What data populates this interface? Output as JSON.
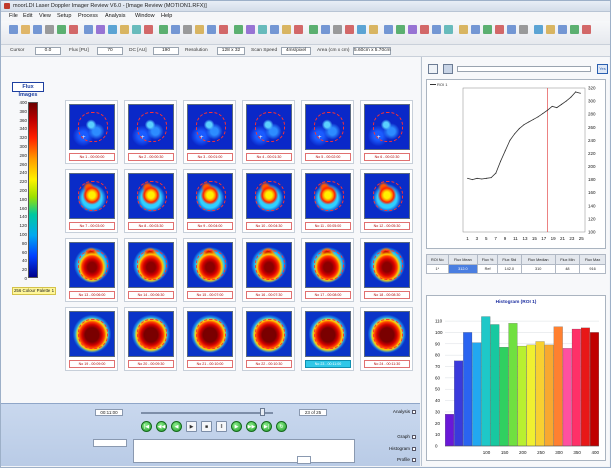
{
  "window": {
    "title": "moorLDI Laser Doppler Imager Review V6.0 - [Image Review (MOTION1.RFX)]"
  },
  "menu": [
    "File",
    "Edit",
    "View",
    "Setup",
    "Process",
    "Analysis",
    "Window",
    "Help"
  ],
  "stats": {
    "cursor_label": "Cursor",
    "cursor_value": "0.0",
    "flux_label": "Flux [PU]",
    "flux_value": "70",
    "dc_label": "DC [AU]",
    "dc_value": "190",
    "resolution_label": "Resolution",
    "resolution_value": "128 x 32",
    "scan_speed_label": "Scan Speed",
    "scan_speed_value": "4ms/pixel",
    "area_label": "Area (cm x cm)",
    "area_value": "5.60cm x 5.70cm"
  },
  "palette": {
    "title": "Flux Images",
    "ticks": [
      "400",
      "380",
      "360",
      "340",
      "320",
      "300",
      "280",
      "260",
      "240",
      "220",
      "200",
      "180",
      "160",
      "140",
      "120",
      "100",
      "80",
      "60",
      "40",
      "20",
      "0"
    ],
    "label": "256 Colour Palette 1",
    "colors": [
      "#6b0000",
      "#ff2000",
      "#fff200",
      "#00c8a0",
      "#0040ff",
      "#00008c"
    ]
  },
  "frames": [
    "No 1 - 00:00:00",
    "No 2 - 00:00:30",
    "No 3 - 00:01:00",
    "No 4 - 00:01:30",
    "No 5 - 00:02:00",
    "No 6 - 00:02:30",
    "No 7 - 00:03:00",
    "No 8 - 00:03:30",
    "No 9 - 00:04:00",
    "No 10 - 00:04:30",
    "No 11 - 00:05:00",
    "No 12 - 00:05:30",
    "No 13 - 00:06:00",
    "No 14 - 00:06:30",
    "No 15 - 00:07:00",
    "No 16 - 00:07:30",
    "No 17 - 00:08:00",
    "No 18 - 00:08:30",
    "No 19 - 00:09:00",
    "No 20 - 00:09:30",
    "No 21 - 00:10:00",
    "No 22 - 00:10:30",
    "No 23 - 00:11:00",
    "No 24 - 00:11:30"
  ],
  "selected_frame": "No 23 - 00:11:00",
  "playback": {
    "time": "00:11:00",
    "frame_counter": "23 of 25",
    "position": 0.92,
    "buttons": [
      "skip-start",
      "rewind",
      "step-back",
      "play",
      "stop",
      "pause",
      "step-forward",
      "fast-forward",
      "skip-end",
      "loop"
    ],
    "side_labels": [
      "Analysis",
      "Graph",
      "Histogram",
      "Profile"
    ]
  },
  "roi_legend": "ROI 1",
  "table": {
    "headers": [
      "ROI No",
      "Flux Mean",
      "Flux %",
      "Flux Std",
      "Flux Median",
      "Flux Min",
      "Flux Max"
    ],
    "row": [
      "1*",
      "312.0",
      "Ref",
      "142.0",
      "310",
      "48",
      "916"
    ]
  },
  "chart_data": [
    {
      "type": "line",
      "title": "",
      "xlabel": "",
      "ylabel": "",
      "xlim": [
        0,
        26
      ],
      "ylim": [
        100,
        320
      ],
      "x_ticks": [
        1,
        3,
        5,
        7,
        9,
        11,
        13,
        15,
        17,
        19,
        21,
        23,
        25
      ],
      "y_ticks": [
        100,
        120,
        140,
        160,
        180,
        200,
        220,
        240,
        260,
        280,
        300,
        320
      ],
      "marker_x": 18,
      "series": [
        {
          "name": "ROI 1",
          "color": "#333333",
          "x": [
            1,
            2,
            3,
            4,
            5,
            6,
            7,
            8,
            9,
            10,
            11,
            12,
            13,
            14,
            15,
            16,
            17,
            18,
            19,
            20,
            21,
            22,
            23,
            24,
            25
          ],
          "values": [
            182,
            180,
            182,
            181,
            182,
            183,
            190,
            208,
            224,
            240,
            250,
            258,
            264,
            268,
            272,
            276,
            281,
            286,
            292,
            290,
            295,
            300,
            306,
            314,
            312
          ]
        }
      ]
    },
    {
      "type": "bar",
      "title": "Histogram (ROI 1)",
      "xlabel": "",
      "ylabel": "",
      "ylim": [
        0,
        118
      ],
      "x_ticks": [
        100,
        150,
        200,
        250,
        300,
        350,
        400
      ],
      "y_ticks": [
        0,
        10,
        20,
        30,
        40,
        50,
        60,
        70,
        80,
        90,
        100,
        110
      ],
      "categories": [
        "0",
        "25",
        "50",
        "75",
        "100",
        "125",
        "150",
        "175",
        "200",
        "225",
        "250",
        "275",
        "300",
        "325",
        "350",
        "375",
        "400"
      ],
      "values": [
        28,
        75,
        100,
        91,
        114,
        107,
        87,
        108,
        88,
        89,
        92,
        89,
        105,
        86,
        103,
        104,
        100
      ],
      "colors": [
        "#6a18d8",
        "#3a3adc",
        "#2a64f0",
        "#22a8f0",
        "#1ec8c8",
        "#18c8a0",
        "#30d060",
        "#70e040",
        "#b8f030",
        "#f0f030",
        "#f8d030",
        "#f8a830",
        "#ff8030",
        "#ff50a0",
        "#ff3068",
        "#e81818",
        "#c00000"
      ]
    }
  ]
}
